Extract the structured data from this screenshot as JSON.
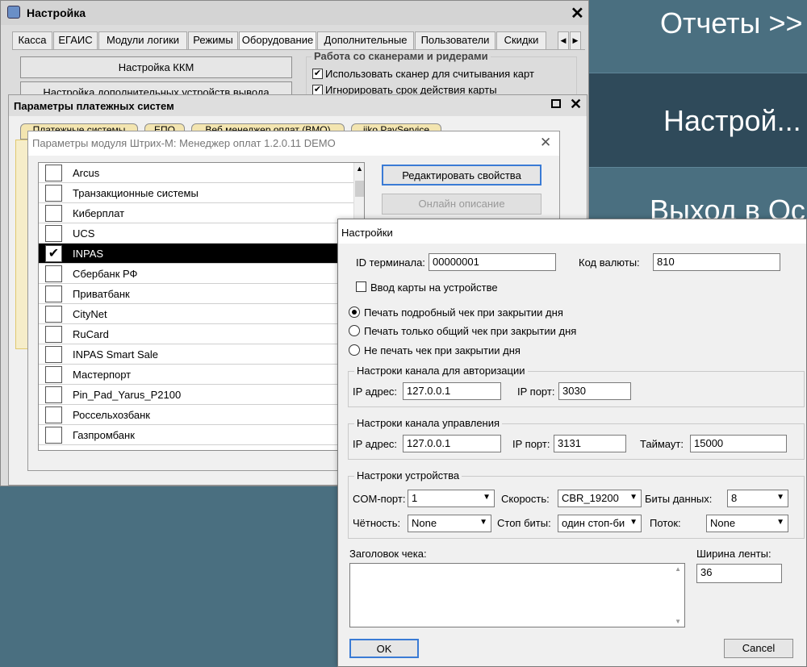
{
  "side_menu": {
    "reports": "Отчеты >>",
    "settings": "Настрой...",
    "exit": "Выход в Ос"
  },
  "main_window": {
    "title": "Настройка",
    "tabs": [
      "Касса",
      "ЕГАИС",
      "Модули логики",
      "Режимы",
      "Оборудование",
      "Дополнительные",
      "Пользователи",
      "Скидки"
    ],
    "kkm_button": "Настройка ККМ",
    "extra_devices_button": "Настройка дополнительных устройств вывода",
    "scanners_group": "Работа со сканерами и ридерами",
    "use_scanner_label": "Использовать сканер для считывания карт",
    "ignore_expiry_label": "Игнорировать срок действия карты"
  },
  "payment_window": {
    "title": "Параметры платежных систем",
    "tabs": [
      "Платежные системы",
      "ЕПО",
      "Веб менеджер оплат (ВМО)",
      "iiko PayService"
    ]
  },
  "module_window": {
    "title": "Параметры модуля Штрих-М: Менеджер оплат 1.2.0.11 DEMO",
    "edit_button": "Редактировать свойства",
    "online_button": "Онлайн описание",
    "items": [
      {
        "label": "Arcus",
        "checked": false
      },
      {
        "label": "Транзакционные системы",
        "checked": false
      },
      {
        "label": "Киберплат",
        "checked": false
      },
      {
        "label": "UCS",
        "checked": false
      },
      {
        "label": "INPAS",
        "checked": true,
        "selected": true
      },
      {
        "label": "Сбербанк РФ",
        "checked": false
      },
      {
        "label": "Приватбанк",
        "checked": false
      },
      {
        "label": "CityNet",
        "checked": false
      },
      {
        "label": "RuCard",
        "checked": false
      },
      {
        "label": "INPAS Smart Sale",
        "checked": false
      },
      {
        "label": "Мастерпорт",
        "checked": false
      },
      {
        "label": "Pin_Pad_Yarus_P2100",
        "checked": false
      },
      {
        "label": "Россельхозбанк",
        "checked": false
      },
      {
        "label": "Газпромбанк",
        "checked": false
      }
    ]
  },
  "settings_dialog": {
    "title": "Настройки",
    "terminal_id_label": "ID терминала:",
    "terminal_id_value": "00000001",
    "currency_code_label": "Код валюты:",
    "currency_code_value": "810",
    "card_input_label": "Ввод карты на устройстве",
    "print_detailed_label": "Печать подробный чек при закрытии дня",
    "print_total_label": "Печать только общий чек при закрытии дня",
    "no_print_label": "Не печать чек при закрытии дня",
    "auth_channel": {
      "title": "Настроки канала для авторизации",
      "ip_label": "IP адрес:",
      "ip_value": "127.0.0.1",
      "port_label": "IP порт:",
      "port_value": "3030"
    },
    "control_channel": {
      "title": "Настроки канала управления",
      "ip_label": "IP адрес:",
      "ip_value": "127.0.0.1",
      "port_label": "IP порт:",
      "port_value": "3131",
      "timeout_label": "Таймаут:",
      "timeout_value": "15000"
    },
    "device": {
      "title": "Настроки устройства",
      "com_label": "COM-порт:",
      "com_value": "1",
      "speed_label": "Скорость:",
      "speed_value": "CBR_19200",
      "databits_label": "Биты данных:",
      "databits_value": "8",
      "parity_label": "Чётность:",
      "parity_value": "None",
      "stopbits_label": "Стоп биты:",
      "stopbits_value": "один стоп-би",
      "flow_label": "Поток:",
      "flow_value": "None"
    },
    "receipt_header_label": "Заголовок чека:",
    "tape_width_label": "Ширина ленты:",
    "tape_width_value": "36",
    "ok_button": "OK",
    "cancel_button": "Cancel"
  }
}
